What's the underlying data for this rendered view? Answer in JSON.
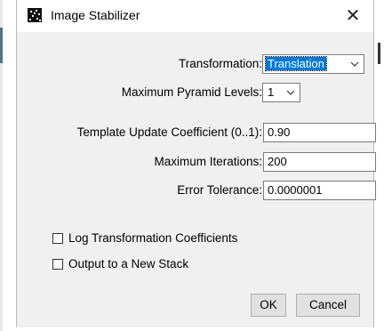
{
  "window": {
    "title": "Image Stabilizer",
    "icon": "image-stabilizer-app-icon",
    "close_symbol": "✕"
  },
  "form": {
    "transformation": {
      "label": "Transformation:",
      "value": "Translation"
    },
    "pyramid_levels": {
      "label": "Maximum Pyramid Levels:",
      "value": "1"
    },
    "template_update": {
      "label": "Template Update Coefficient (0..1):",
      "value": "0.90"
    },
    "max_iterations": {
      "label": "Maximum Iterations:",
      "value": "200"
    },
    "error_tolerance": {
      "label": "Error Tolerance:",
      "value": "0.0000001"
    }
  },
  "options": {
    "log_coefficients": {
      "label": "Log Transformation Coefficients",
      "checked": false
    },
    "output_new_stack": {
      "label": "Output to a New Stack",
      "checked": false
    }
  },
  "buttons": {
    "ok": "OK",
    "cancel": "Cancel"
  },
  "colors": {
    "selection": "#0078d7",
    "dialog_bg": "#f0f0f0",
    "titlebar_bg": "#ffffff"
  }
}
